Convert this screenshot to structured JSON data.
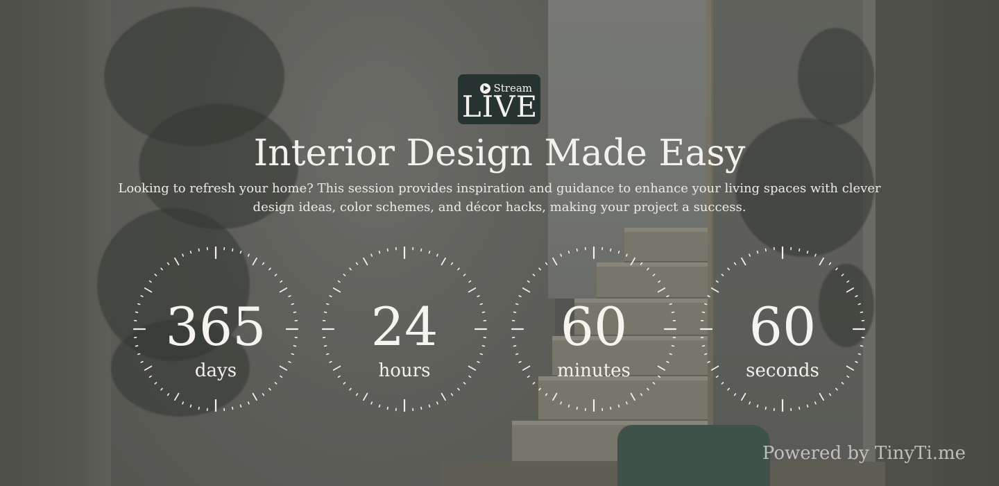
{
  "badge": {
    "stream_label": "Stream",
    "live_label": "LIVE"
  },
  "event": {
    "title": "Interior Design Made Easy",
    "description": "Looking to refresh your home? This session provides inspiration and guidance to enhance your living spaces with clever design ideas, color schemes, and décor hacks, making your project a success."
  },
  "countdown": [
    {
      "value": "365",
      "unit": "days"
    },
    {
      "value": "24",
      "unit": "hours"
    },
    {
      "value": "60",
      "unit": "minutes"
    },
    {
      "value": "60",
      "unit": "seconds"
    }
  ],
  "footer": {
    "powered_by": "Powered by TinyTi.me"
  },
  "colors": {
    "badge_bg": "#263330",
    "text": "#f2f1ec"
  }
}
